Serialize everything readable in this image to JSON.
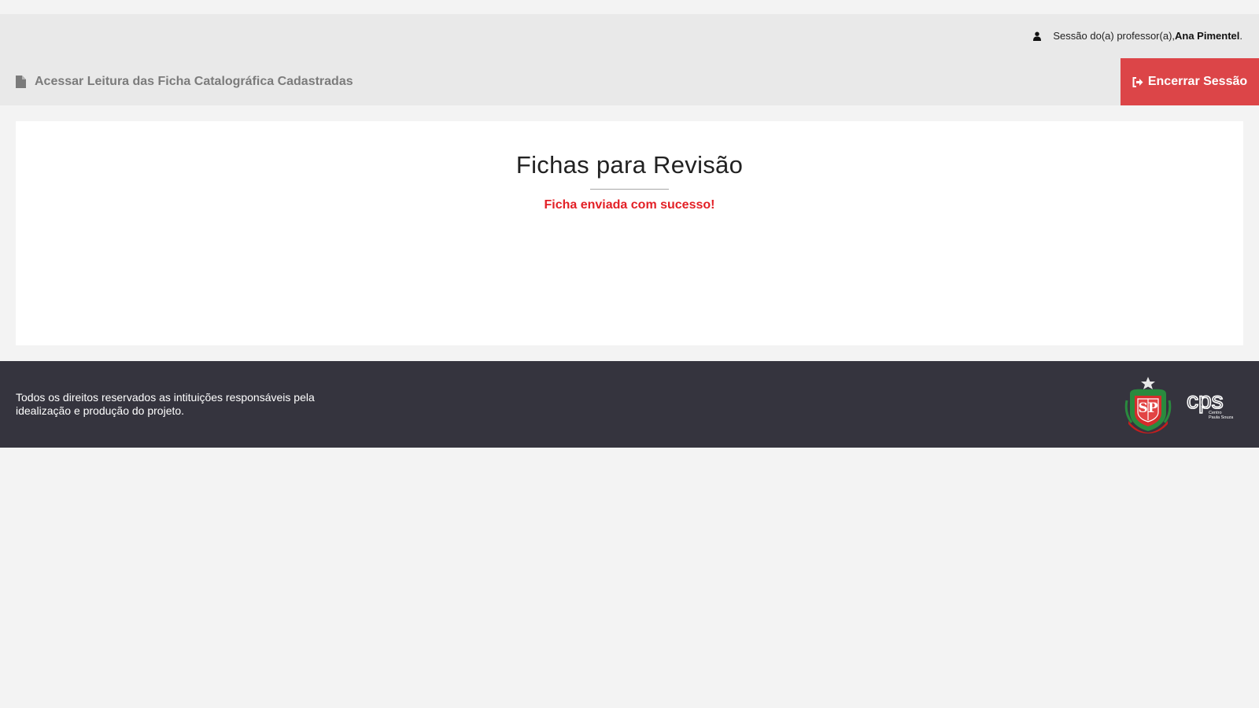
{
  "header": {
    "session_prefix": "Sessão do(a) professor(a), ",
    "user_name": "Ana Pimentel",
    "session_suffix": ".",
    "nav_link_label": "Acessar Leitura das Ficha Catalográfica Cadastradas",
    "logout_label": "Encerrar Sessão",
    "icons": {
      "user": "user-icon",
      "file": "file-icon",
      "logout": "sign-out-icon"
    }
  },
  "main": {
    "title": "Fichas para Revisão",
    "message": "Ficha enviada com sucesso!"
  },
  "footer": {
    "rights_text": "Todos os direitos reservados as intituições responsáveis pela idealização e produção do projeto.",
    "logos": [
      "sao-paulo-state-coat-of-arms",
      "centro-paula-souza-logo"
    ],
    "cps_logo_text": "cps",
    "cps_logo_sub1": "Centro",
    "cps_logo_sub2": "Paula Souza"
  },
  "colors": {
    "header_bg": "#e9e9e9",
    "logout_bg": "#dc4548",
    "message": "#e32026",
    "footer_bg": "#35343e",
    "page_bg": "#f3f3f3"
  }
}
